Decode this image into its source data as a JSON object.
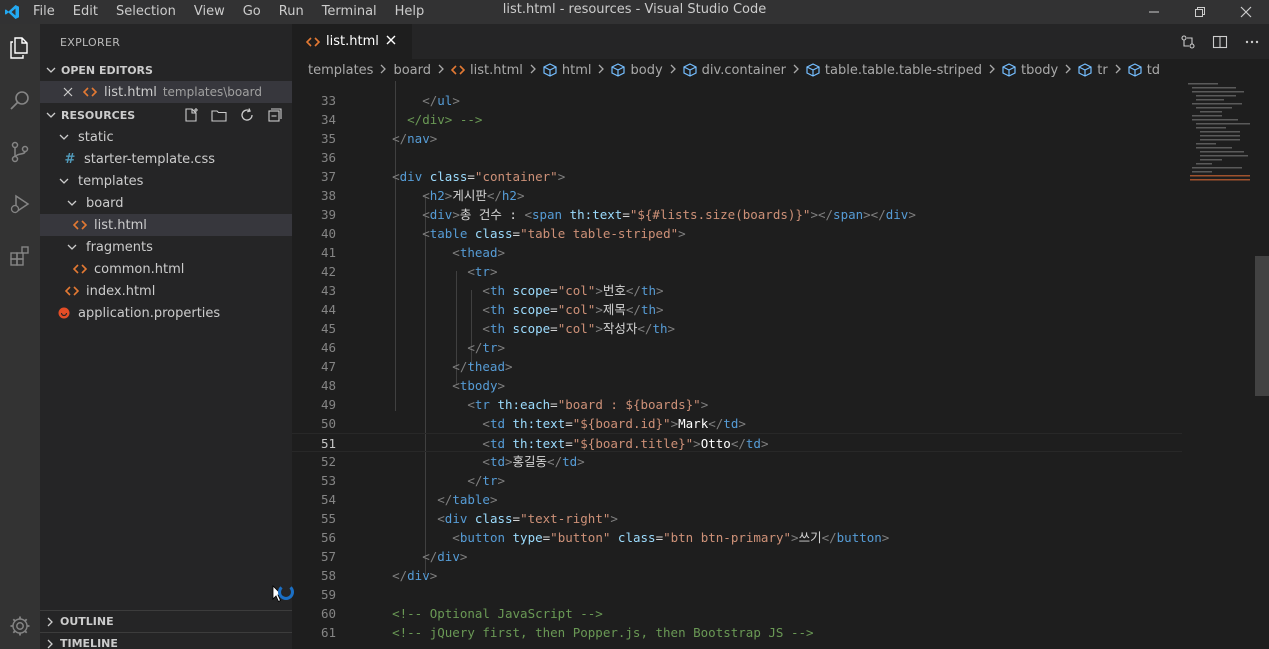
{
  "titlebar": {
    "menu": [
      "File",
      "Edit",
      "Selection",
      "View",
      "Go",
      "Run",
      "Terminal",
      "Help"
    ],
    "title": "list.html - resources - Visual Studio Code"
  },
  "sidebar": {
    "title": "EXPLORER",
    "open_editors_label": "OPEN EDITORS",
    "open_editor": {
      "name": "list.html",
      "path": "templates\\board"
    },
    "resources_label": "RESOURCES",
    "tree": {
      "static": "static",
      "starter_css": "starter-template.css",
      "templates": "templates",
      "board": "board",
      "list_html": "list.html",
      "fragments": "fragments",
      "common_html": "common.html",
      "index_html": "index.html",
      "app_props": "application.properties"
    },
    "outline_label": "OUTLINE",
    "timeline_label": "TIMELINE"
  },
  "editor": {
    "tab_label": "list.html",
    "breadcrumb": [
      "templates",
      "board",
      "list.html",
      "html",
      "body",
      "div.container",
      "table.table.table-striped",
      "tbody",
      "tr",
      "td"
    ],
    "lines": [
      {
        "n": "33",
        "tokens": [
          [
            "tk-pun",
            "        </"
          ],
          [
            "tk-tag",
            "ul"
          ],
          [
            "tk-pun",
            ">"
          ]
        ]
      },
      {
        "n": "34",
        "tokens": [
          [
            "tk-cm",
            "      </div> -->"
          ]
        ]
      },
      {
        "n": "35",
        "tokens": [
          [
            "tk-pun",
            "    </"
          ],
          [
            "tk-tag",
            "nav"
          ],
          [
            "tk-pun",
            ">"
          ]
        ]
      },
      {
        "n": "36",
        "tokens": []
      },
      {
        "n": "37",
        "tokens": [
          [
            "tk-pun",
            "    <"
          ],
          [
            "tk-tag",
            "div"
          ],
          [
            "tk-text",
            " "
          ],
          [
            "tk-attr",
            "class"
          ],
          [
            "tk-text",
            "="
          ],
          [
            "tk-str",
            "\"container\""
          ],
          [
            "tk-pun",
            ">"
          ]
        ]
      },
      {
        "n": "38",
        "tokens": [
          [
            "tk-pun",
            "        <"
          ],
          [
            "tk-tag",
            "h2"
          ],
          [
            "tk-pun",
            ">"
          ],
          [
            "tk-text",
            "게시판"
          ],
          [
            "tk-pun",
            "</"
          ],
          [
            "tk-tag",
            "h2"
          ],
          [
            "tk-pun",
            ">"
          ]
        ]
      },
      {
        "n": "39",
        "tokens": [
          [
            "tk-pun",
            "        <"
          ],
          [
            "tk-tag",
            "div"
          ],
          [
            "tk-pun",
            ">"
          ],
          [
            "tk-text",
            "총 건수 : "
          ],
          [
            "tk-pun",
            "<"
          ],
          [
            "tk-tag",
            "span"
          ],
          [
            "tk-text",
            " "
          ],
          [
            "tk-attr",
            "th:text"
          ],
          [
            "tk-text",
            "="
          ],
          [
            "tk-str",
            "\"${#lists.size(boards)}\""
          ],
          [
            "tk-pun",
            "></"
          ],
          [
            "tk-tag",
            "span"
          ],
          [
            "tk-pun",
            "></"
          ],
          [
            "tk-tag",
            "div"
          ],
          [
            "tk-pun",
            ">"
          ]
        ]
      },
      {
        "n": "40",
        "tokens": [
          [
            "tk-pun",
            "        <"
          ],
          [
            "tk-tag",
            "table"
          ],
          [
            "tk-text",
            " "
          ],
          [
            "tk-attr",
            "class"
          ],
          [
            "tk-text",
            "="
          ],
          [
            "tk-str",
            "\"table table-striped\""
          ],
          [
            "tk-pun",
            ">"
          ]
        ]
      },
      {
        "n": "41",
        "tokens": [
          [
            "tk-pun",
            "            <"
          ],
          [
            "tk-tag",
            "thead"
          ],
          [
            "tk-pun",
            ">"
          ]
        ]
      },
      {
        "n": "42",
        "tokens": [
          [
            "tk-pun",
            "              <"
          ],
          [
            "tk-tag",
            "tr"
          ],
          [
            "tk-pun",
            ">"
          ]
        ]
      },
      {
        "n": "43",
        "tokens": [
          [
            "tk-pun",
            "                <"
          ],
          [
            "tk-tag",
            "th"
          ],
          [
            "tk-text",
            " "
          ],
          [
            "tk-attr",
            "scope"
          ],
          [
            "tk-text",
            "="
          ],
          [
            "tk-str",
            "\"col\""
          ],
          [
            "tk-pun",
            ">"
          ],
          [
            "tk-text",
            "번호"
          ],
          [
            "tk-pun",
            "</"
          ],
          [
            "tk-tag",
            "th"
          ],
          [
            "tk-pun",
            ">"
          ]
        ]
      },
      {
        "n": "44",
        "tokens": [
          [
            "tk-pun",
            "                <"
          ],
          [
            "tk-tag",
            "th"
          ],
          [
            "tk-text",
            " "
          ],
          [
            "tk-attr",
            "scope"
          ],
          [
            "tk-text",
            "="
          ],
          [
            "tk-str",
            "\"col\""
          ],
          [
            "tk-pun",
            ">"
          ],
          [
            "tk-text",
            "제목"
          ],
          [
            "tk-pun",
            "</"
          ],
          [
            "tk-tag",
            "th"
          ],
          [
            "tk-pun",
            ">"
          ]
        ]
      },
      {
        "n": "45",
        "tokens": [
          [
            "tk-pun",
            "                <"
          ],
          [
            "tk-tag",
            "th"
          ],
          [
            "tk-text",
            " "
          ],
          [
            "tk-attr",
            "scope"
          ],
          [
            "tk-text",
            "="
          ],
          [
            "tk-str",
            "\"col\""
          ],
          [
            "tk-pun",
            ">"
          ],
          [
            "tk-text",
            "작성자"
          ],
          [
            "tk-pun",
            "</"
          ],
          [
            "tk-tag",
            "th"
          ],
          [
            "tk-pun",
            ">"
          ]
        ]
      },
      {
        "n": "46",
        "tokens": [
          [
            "tk-pun",
            "              </"
          ],
          [
            "tk-tag",
            "tr"
          ],
          [
            "tk-pun",
            ">"
          ]
        ]
      },
      {
        "n": "47",
        "tokens": [
          [
            "tk-pun",
            "            </"
          ],
          [
            "tk-tag",
            "thead"
          ],
          [
            "tk-pun",
            ">"
          ]
        ]
      },
      {
        "n": "48",
        "tokens": [
          [
            "tk-pun",
            "            <"
          ],
          [
            "tk-tag",
            "tbody"
          ],
          [
            "tk-pun",
            ">"
          ]
        ]
      },
      {
        "n": "49",
        "tokens": [
          [
            "tk-pun",
            "              <"
          ],
          [
            "tk-tag",
            "tr"
          ],
          [
            "tk-text",
            " "
          ],
          [
            "tk-attr",
            "th:each"
          ],
          [
            "tk-text",
            "="
          ],
          [
            "tk-str",
            "\"board : ${boards}\""
          ],
          [
            "tk-pun",
            ">"
          ]
        ]
      },
      {
        "n": "50",
        "tokens": [
          [
            "tk-pun",
            "                <"
          ],
          [
            "tk-tag",
            "td"
          ],
          [
            "tk-text",
            " "
          ],
          [
            "tk-attr",
            "th:text"
          ],
          [
            "tk-text",
            "="
          ],
          [
            "tk-str",
            "\"${board.id}\""
          ],
          [
            "tk-pun",
            ">"
          ],
          [
            "tk-val",
            "Mark"
          ],
          [
            "tk-pun",
            "</"
          ],
          [
            "tk-tag",
            "td"
          ],
          [
            "tk-pun",
            ">"
          ]
        ]
      },
      {
        "n": "51",
        "current": true,
        "tokens": [
          [
            "tk-pun",
            "                <"
          ],
          [
            "tk-tag",
            "td"
          ],
          [
            "tk-text",
            " "
          ],
          [
            "tk-attr",
            "th:text"
          ],
          [
            "tk-text",
            "="
          ],
          [
            "tk-str",
            "\"${board.title}\""
          ],
          [
            "tk-pun",
            ">"
          ],
          [
            "tk-val",
            "Otto"
          ],
          [
            "tk-pun",
            "</"
          ],
          [
            "tk-tag",
            "td"
          ],
          [
            "tk-pun",
            ">"
          ]
        ]
      },
      {
        "n": "52",
        "tokens": [
          [
            "tk-pun",
            "                <"
          ],
          [
            "tk-tag",
            "td"
          ],
          [
            "tk-pun",
            ">"
          ],
          [
            "tk-text",
            "홍길동"
          ],
          [
            "tk-pun",
            "</"
          ],
          [
            "tk-tag",
            "td"
          ],
          [
            "tk-pun",
            ">"
          ]
        ]
      },
      {
        "n": "53",
        "tokens": [
          [
            "tk-pun",
            "              </"
          ],
          [
            "tk-tag",
            "tr"
          ],
          [
            "tk-pun",
            ">"
          ]
        ]
      },
      {
        "n": "54",
        "tokens": [
          [
            "tk-pun",
            "          </"
          ],
          [
            "tk-tag",
            "table"
          ],
          [
            "tk-pun",
            ">"
          ]
        ]
      },
      {
        "n": "55",
        "tokens": [
          [
            "tk-pun",
            "          <"
          ],
          [
            "tk-tag",
            "div"
          ],
          [
            "tk-text",
            " "
          ],
          [
            "tk-attr",
            "class"
          ],
          [
            "tk-text",
            "="
          ],
          [
            "tk-str",
            "\"text-right\""
          ],
          [
            "tk-pun",
            ">"
          ]
        ]
      },
      {
        "n": "56",
        "tokens": [
          [
            "tk-pun",
            "            <"
          ],
          [
            "tk-tag",
            "button"
          ],
          [
            "tk-text",
            " "
          ],
          [
            "tk-attr",
            "type"
          ],
          [
            "tk-text",
            "="
          ],
          [
            "tk-str",
            "\"button\""
          ],
          [
            "tk-text",
            " "
          ],
          [
            "tk-attr",
            "class"
          ],
          [
            "tk-text",
            "="
          ],
          [
            "tk-str",
            "\"btn btn-primary\""
          ],
          [
            "tk-pun",
            ">"
          ],
          [
            "tk-text",
            "쓰기"
          ],
          [
            "tk-pun",
            "</"
          ],
          [
            "tk-tag",
            "button"
          ],
          [
            "tk-pun",
            ">"
          ]
        ]
      },
      {
        "n": "57",
        "tokens": [
          [
            "tk-pun",
            "        </"
          ],
          [
            "tk-tag",
            "div"
          ],
          [
            "tk-pun",
            ">"
          ]
        ]
      },
      {
        "n": "58",
        "tokens": [
          [
            "tk-pun",
            "    </"
          ],
          [
            "tk-tag",
            "div"
          ],
          [
            "tk-pun",
            ">"
          ]
        ]
      },
      {
        "n": "59",
        "tokens": []
      },
      {
        "n": "60",
        "tokens": [
          [
            "tk-cm",
            "    <!-- Optional JavaScript -->"
          ]
        ]
      },
      {
        "n": "61",
        "tokens": [
          [
            "tk-cm",
            "    <!-- jQuery first, then Popper.js, then Bootstrap JS -->"
          ]
        ]
      }
    ]
  },
  "colors": {
    "accent": "#007acc",
    "html_file_icon": "#e37933",
    "css_file_icon": "#519aba",
    "properties_icon": "#e44d26"
  }
}
